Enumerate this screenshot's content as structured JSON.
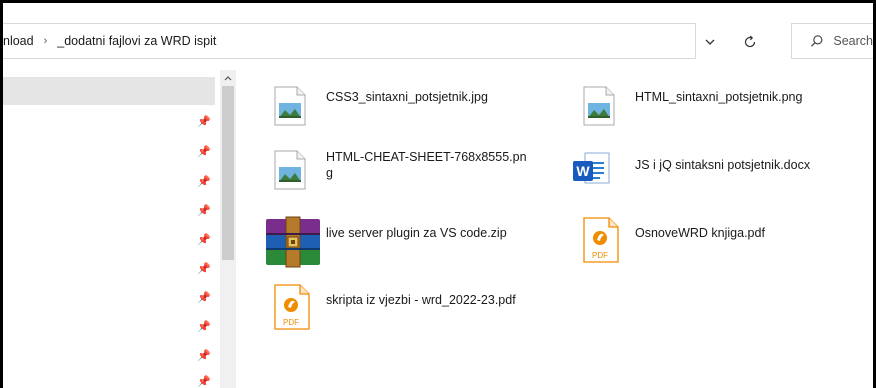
{
  "address": {
    "crumbs": [
      "nload",
      "_dodatni fajlovi za WRD ispit"
    ],
    "separator": "›"
  },
  "search": {
    "placeholder": "Search"
  },
  "files": [
    {
      "name": "CSS3_sintaxni_potsjetnik.jpg",
      "icon": "image-file-icon"
    },
    {
      "name": "HTML_sintaxni_potsjetnik.png",
      "icon": "image-file-icon"
    },
    {
      "name": "HTML-CHEAT-SHEET-768x8555.png",
      "name_line1": "HTML-CHEAT-SHEET-768x8555.pn",
      "name_line2": "g",
      "icon": "image-file-icon"
    },
    {
      "name": "JS i jQ sintaksni potsjetnik.docx",
      "icon": "word-document-icon"
    },
    {
      "name": "live server plugin za VS code.zip",
      "icon": "winrar-archive-icon"
    },
    {
      "name": "OsnoveWRD knjiga.pdf",
      "icon": "pdf-file-icon",
      "icon_label": "PDF"
    },
    {
      "name": "skripta iz vjezbi - wrd_2022-23.pdf",
      "icon": "pdf-file-icon",
      "icon_label": "PDF"
    }
  ],
  "colors": {
    "pdf_orange": "#f08c00",
    "word_blue": "#185abd",
    "selection_gray": "#e5e5e5"
  }
}
